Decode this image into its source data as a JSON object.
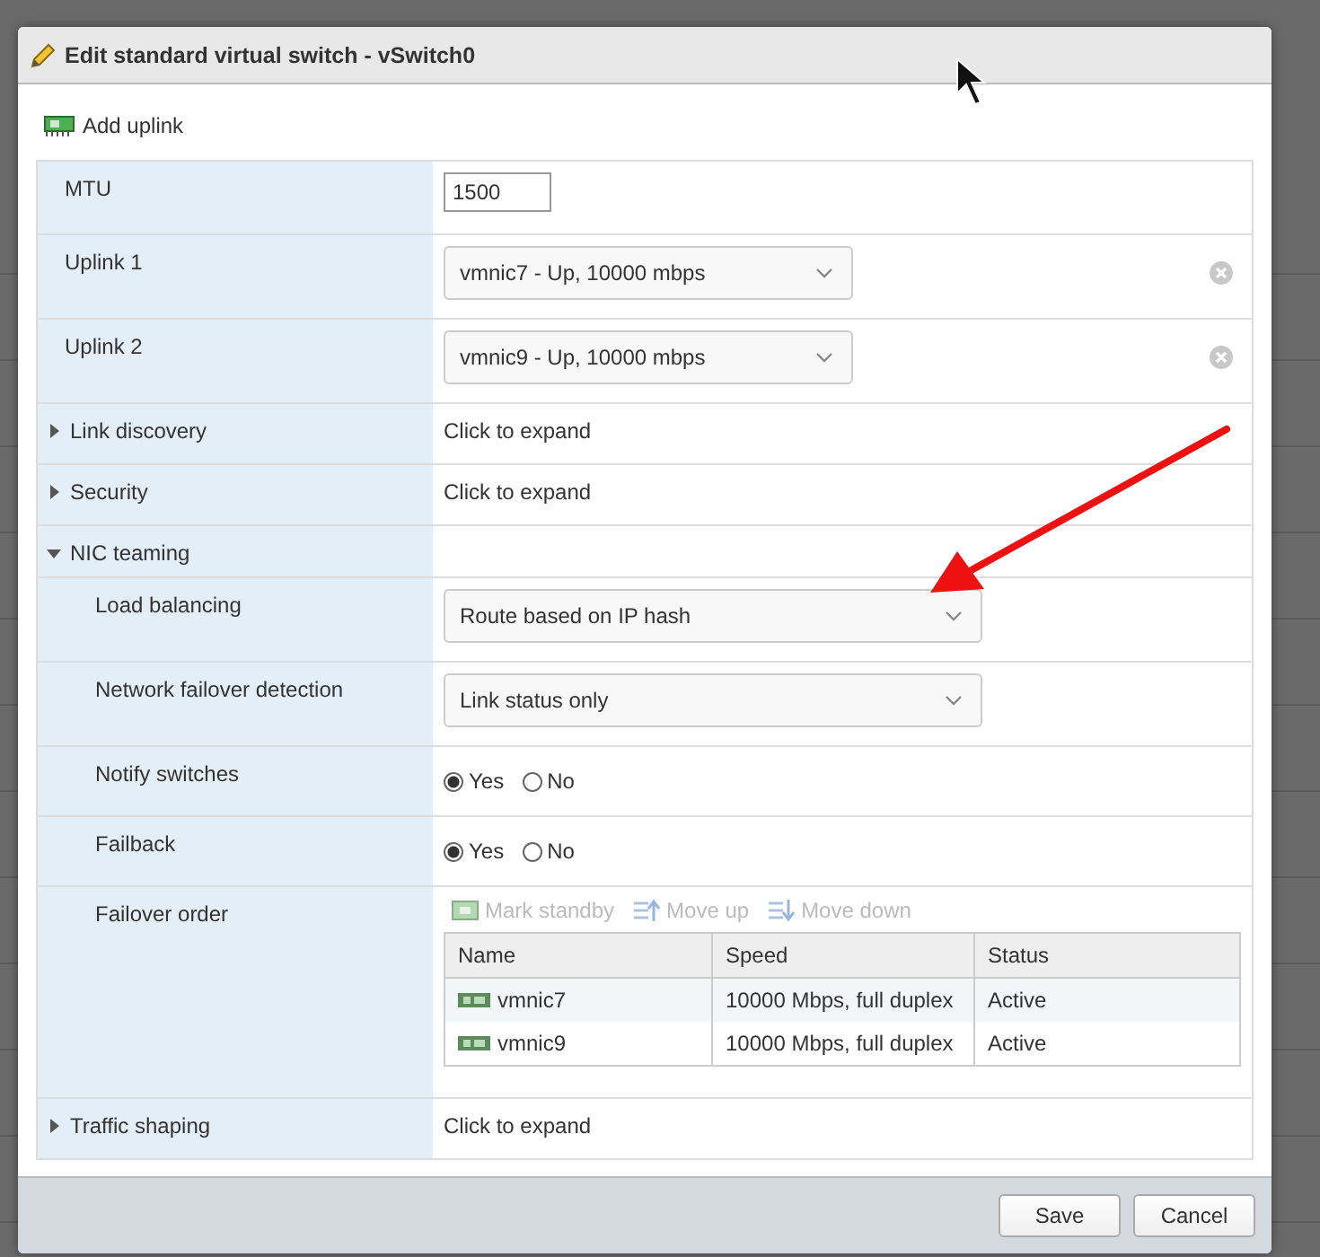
{
  "dialog": {
    "title": "Edit standard virtual switch - vSwitch0"
  },
  "toolbar": {
    "add_uplink": "Add uplink"
  },
  "rows": [
    {
      "kind": "input",
      "label": "MTU",
      "value": "1500"
    },
    {
      "kind": "select",
      "label": "Uplink 1",
      "value": "vmnic7 - Up, 10000 mbps",
      "removable": true
    },
    {
      "kind": "select",
      "label": "Uplink 2",
      "value": "vmnic9 - Up, 10000 mbps",
      "removable": true
    },
    {
      "kind": "section",
      "label": "Link discovery",
      "expanded": false,
      "value": "Click to expand"
    },
    {
      "kind": "section",
      "label": "Security",
      "expanded": false,
      "value": "Click to expand"
    },
    {
      "kind": "section",
      "label": "NIC teaming",
      "expanded": true,
      "children": [
        {
          "kind": "select",
          "label": "Load balancing",
          "value": "Route based on IP hash"
        },
        {
          "kind": "select",
          "label": "Network failover detection",
          "value": "Link status only"
        },
        {
          "kind": "radio",
          "label": "Notify switches",
          "options": [
            {
              "label": "Yes",
              "selected": true
            },
            {
              "label": "No",
              "selected": false
            }
          ]
        },
        {
          "kind": "radio",
          "label": "Failback",
          "options": [
            {
              "label": "Yes",
              "selected": true
            },
            {
              "label": "No",
              "selected": false
            }
          ]
        },
        {
          "kind": "failover",
          "label": "Failover order",
          "actions": [
            {
              "label": "Mark standby",
              "disabled": true
            },
            {
              "label": "Move up",
              "disabled": true
            },
            {
              "label": "Move down",
              "disabled": true
            }
          ],
          "columns": [
            "Name",
            "Speed",
            "Status"
          ],
          "nics": [
            {
              "name": "vmnic7",
              "speed": "10000 Mbps, full duplex",
              "status": "Active"
            },
            {
              "name": "vmnic9",
              "speed": "10000 Mbps, full duplex",
              "status": "Active"
            }
          ]
        }
      ]
    },
    {
      "kind": "section",
      "label": "Traffic shaping",
      "expanded": false,
      "value": "Click to expand"
    }
  ],
  "buttons": [
    "Save",
    "Cancel"
  ]
}
